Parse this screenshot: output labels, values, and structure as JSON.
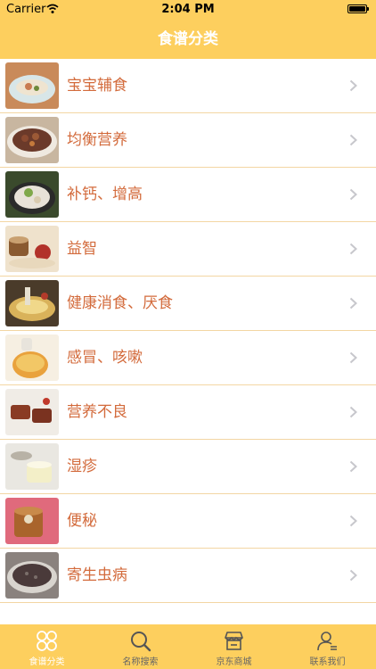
{
  "status_bar": {
    "carrier": "Carrier",
    "time": "2:04 PM"
  },
  "nav": {
    "title": "食谱分类"
  },
  "categories": [
    {
      "label": "宝宝辅食",
      "thumb_colors": [
        "#d8e6e8",
        "#c97c52"
      ]
    },
    {
      "label": "均衡营养",
      "thumb_colors": [
        "#6b3a2a",
        "#c8b6a0"
      ]
    },
    {
      "label": "补钙、增高",
      "thumb_colors": [
        "#3a4a2c",
        "#e8e2d8"
      ]
    },
    {
      "label": "益智",
      "thumb_colors": [
        "#efe2cc",
        "#b2322a"
      ]
    },
    {
      "label": "健康消食、厌食",
      "thumb_colors": [
        "#4a3b2a",
        "#d9b25a"
      ]
    },
    {
      "label": "感冒、咳嗽",
      "thumb_colors": [
        "#f2c766",
        "#e9a23d"
      ]
    },
    {
      "label": "营养不良",
      "thumb_colors": [
        "#8a3b24",
        "#f0ece6"
      ]
    },
    {
      "label": "湿疹",
      "thumb_colors": [
        "#e9e7e1",
        "#f3efc8"
      ]
    },
    {
      "label": "便秘",
      "thumb_colors": [
        "#e06a7c",
        "#a9642c"
      ]
    },
    {
      "label": "寄生虫病",
      "thumb_colors": [
        "#7a6e6a",
        "#4a3a3a"
      ]
    }
  ],
  "tabs": [
    {
      "label": "食谱分类",
      "icon": "grid-icon",
      "active": true
    },
    {
      "label": "名称搜索",
      "icon": "search-icon",
      "active": false
    },
    {
      "label": "京东商城",
      "icon": "store-icon",
      "active": false
    },
    {
      "label": "联系我们",
      "icon": "contact-icon",
      "active": false
    }
  ],
  "colors": {
    "accent": "#fdcf5e",
    "label_text": "#d36b3c",
    "separator": "#f3d6a3",
    "chevron": "#c7c7cc"
  }
}
